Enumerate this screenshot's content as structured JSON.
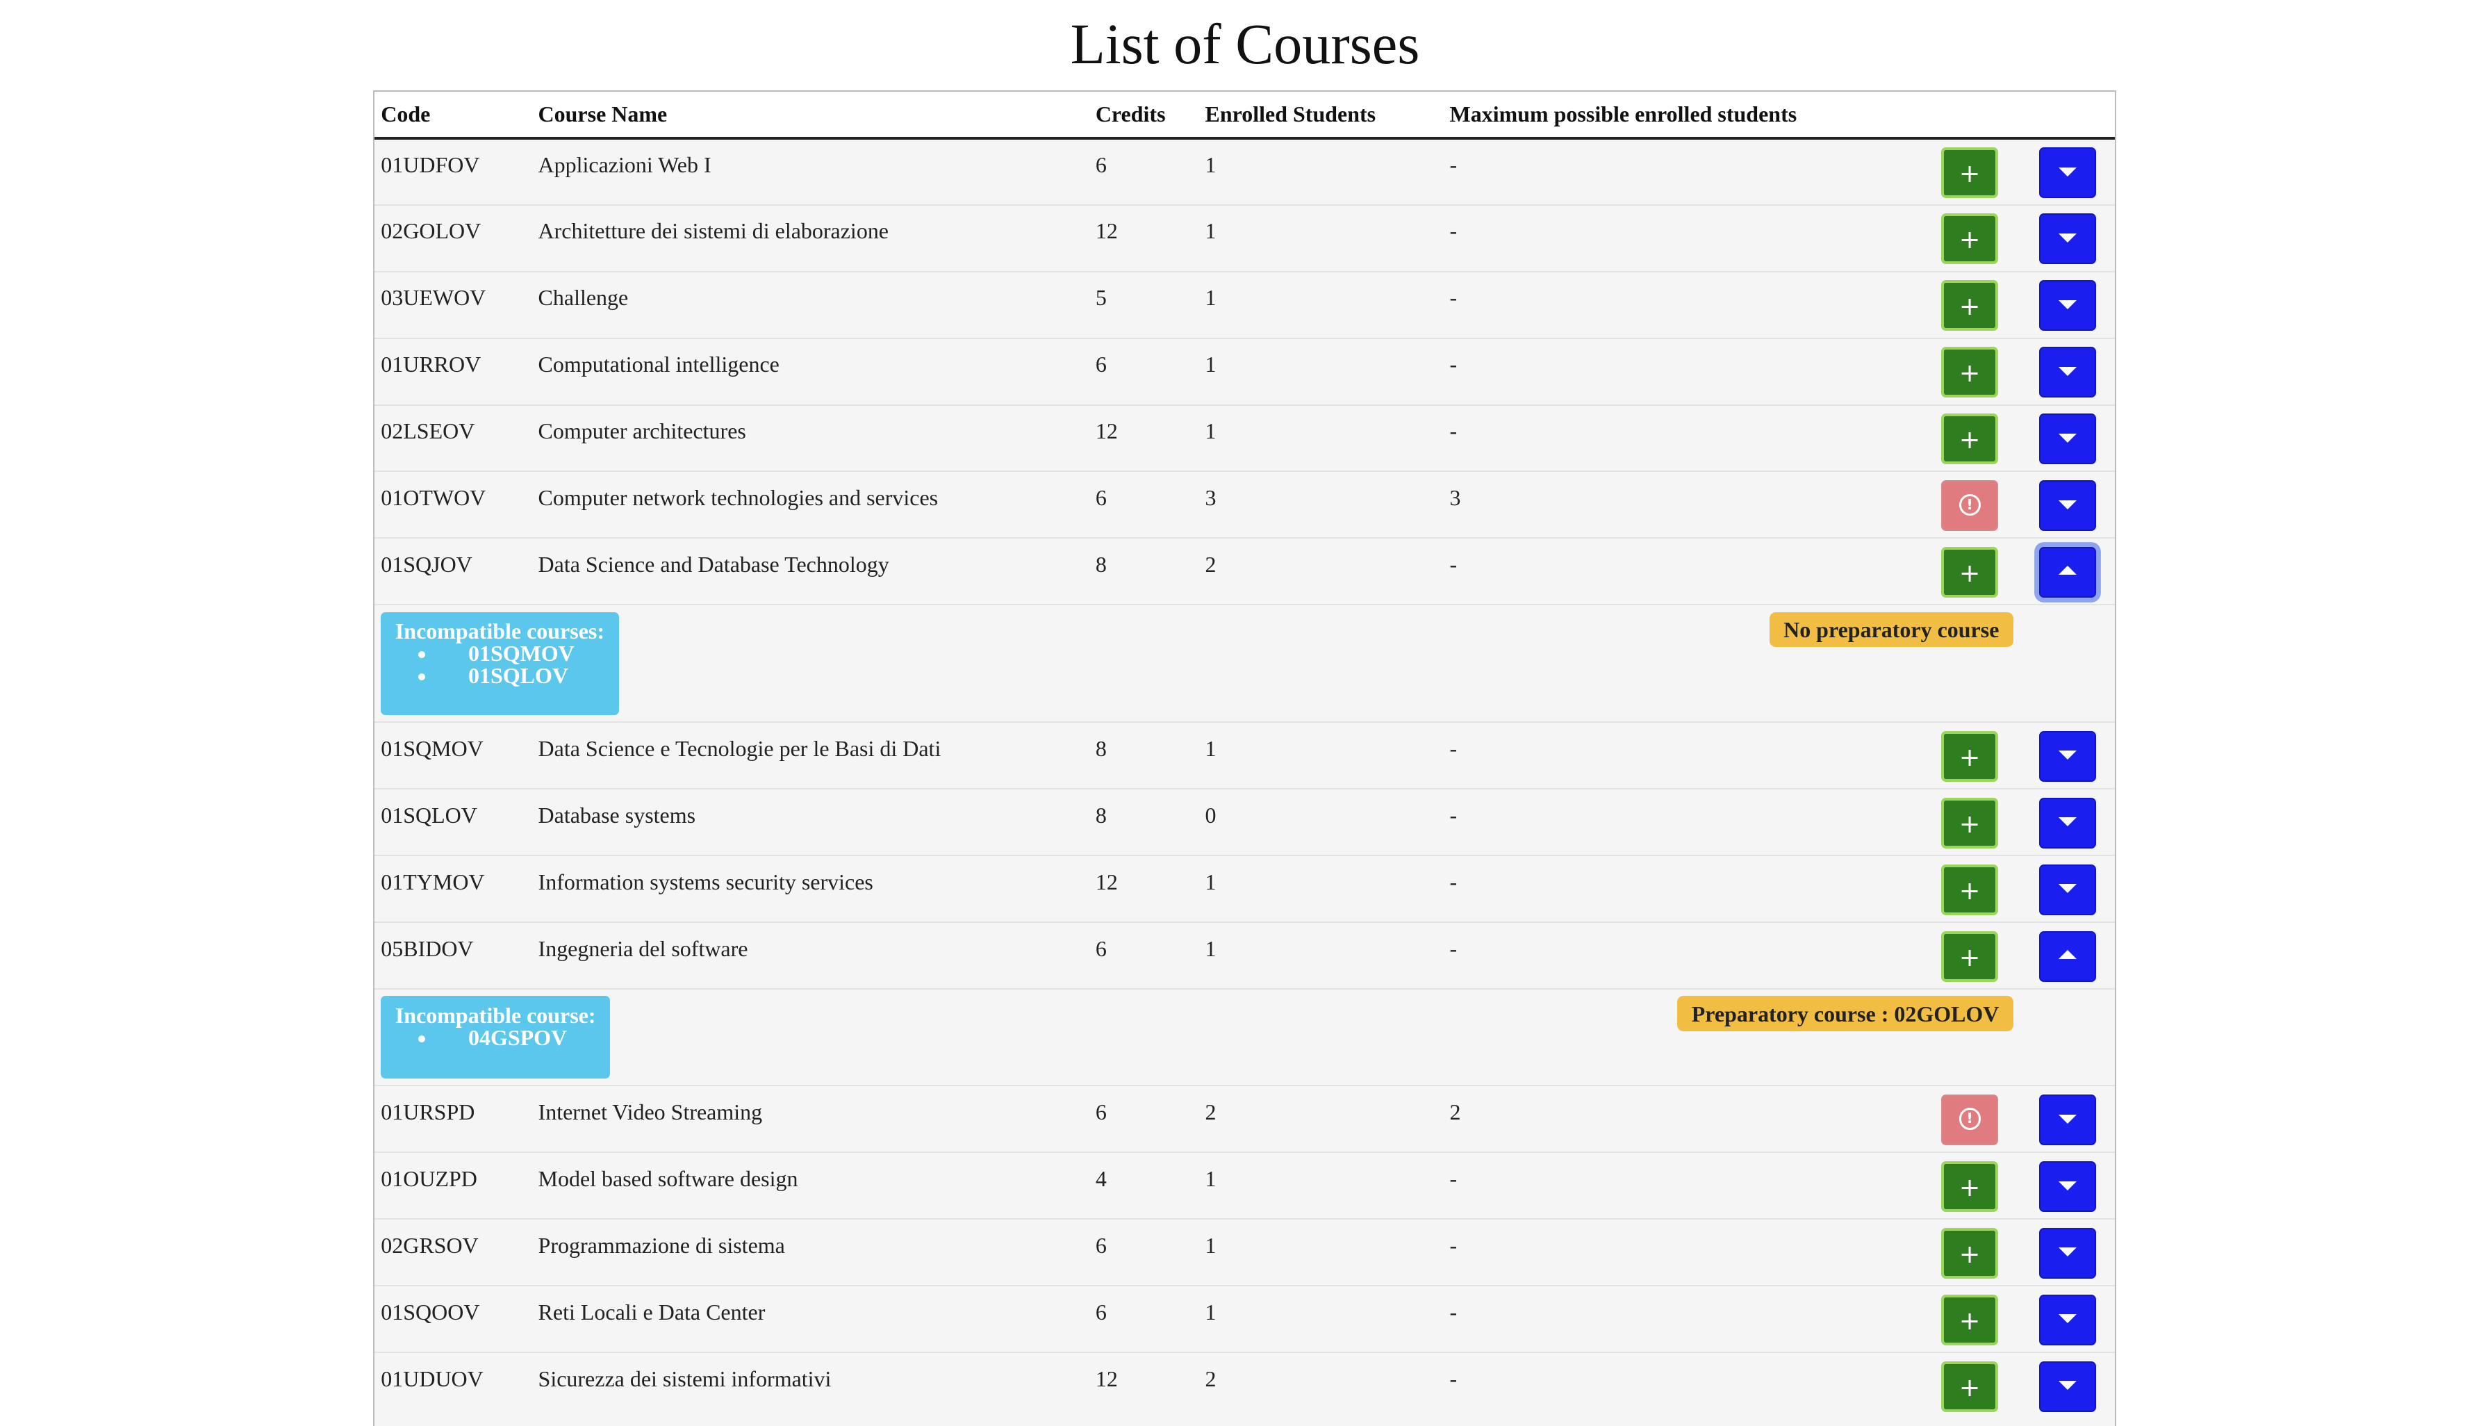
{
  "page": {
    "title": "List of Courses"
  },
  "table": {
    "headers": [
      "Code",
      "Course Name",
      "Credits",
      "Enrolled Students",
      "Maximum possible enrolled students"
    ],
    "rows": [
      {
        "code": "01UDFOV",
        "name": "Applicazioni Web I",
        "credits": "6",
        "enrolled": "1",
        "max": "-",
        "action": "add",
        "expanded": false
      },
      {
        "code": "02GOLOV",
        "name": "Architetture dei sistemi di elaborazione",
        "credits": "12",
        "enrolled": "1",
        "max": "-",
        "action": "add",
        "expanded": false
      },
      {
        "code": "03UEWOV",
        "name": "Challenge",
        "credits": "5",
        "enrolled": "1",
        "max": "-",
        "action": "add",
        "expanded": false
      },
      {
        "code": "01URROV",
        "name": "Computational intelligence",
        "credits": "6",
        "enrolled": "1",
        "max": "-",
        "action": "add",
        "expanded": false
      },
      {
        "code": "02LSEOV",
        "name": "Computer architectures",
        "credits": "12",
        "enrolled": "1",
        "max": "-",
        "action": "add",
        "expanded": false
      },
      {
        "code": "01OTWOV",
        "name": "Computer network technologies and services",
        "credits": "6",
        "enrolled": "3",
        "max": "3",
        "action": "full",
        "expanded": false
      },
      {
        "code": "01SQJOV",
        "name": "Data Science and Database Technology",
        "credits": "8",
        "enrolled": "2",
        "max": "-",
        "action": "add",
        "expanded": true,
        "focused": true,
        "details": {
          "incompatible_title": "Incompatible courses:",
          "incompatible": [
            "01SQMOV",
            "01SQLOV"
          ],
          "preparatory": "No preparatory course"
        }
      },
      {
        "code": "01SQMOV",
        "name": "Data Science e Tecnologie per le Basi di Dati",
        "credits": "8",
        "enrolled": "1",
        "max": "-",
        "action": "add",
        "expanded": false
      },
      {
        "code": "01SQLOV",
        "name": "Database systems",
        "credits": "8",
        "enrolled": "0",
        "max": "-",
        "action": "add",
        "expanded": false
      },
      {
        "code": "01TYMOV",
        "name": "Information systems security services",
        "credits": "12",
        "enrolled": "1",
        "max": "-",
        "action": "add",
        "expanded": false
      },
      {
        "code": "05BIDOV",
        "name": "Ingegneria del software",
        "credits": "6",
        "enrolled": "1",
        "max": "-",
        "action": "add",
        "expanded": true,
        "details": {
          "incompatible_title": "Incompatible course:",
          "incompatible": [
            "04GSPOV"
          ],
          "preparatory": "Preparatory course : 02GOLOV"
        }
      },
      {
        "code": "01URSPD",
        "name": "Internet Video Streaming",
        "credits": "6",
        "enrolled": "2",
        "max": "2",
        "action": "full",
        "expanded": false
      },
      {
        "code": "01OUZPD",
        "name": "Model based software design",
        "credits": "4",
        "enrolled": "1",
        "max": "-",
        "action": "add",
        "expanded": false
      },
      {
        "code": "02GRSOV",
        "name": "Programmazione di sistema",
        "credits": "6",
        "enrolled": "1",
        "max": "-",
        "action": "add",
        "expanded": false
      },
      {
        "code": "01SQOOV",
        "name": "Reti Locali e Data Center",
        "credits": "6",
        "enrolled": "1",
        "max": "-",
        "action": "add",
        "expanded": false
      },
      {
        "code": "01UDUOV",
        "name": "Sicurezza dei sistemi informativi",
        "credits": "12",
        "enrolled": "2",
        "max": "-",
        "action": "add",
        "expanded": false
      }
    ]
  },
  "buttons": {
    "add_label": "+",
    "full_label": "!"
  },
  "colors": {
    "add": "#2e7d1f",
    "full": "#e07b80",
    "toggle": "#1a1ff0",
    "incompatible_badge": "#5bc7ec",
    "preparatory_badge": "#f1be43"
  }
}
